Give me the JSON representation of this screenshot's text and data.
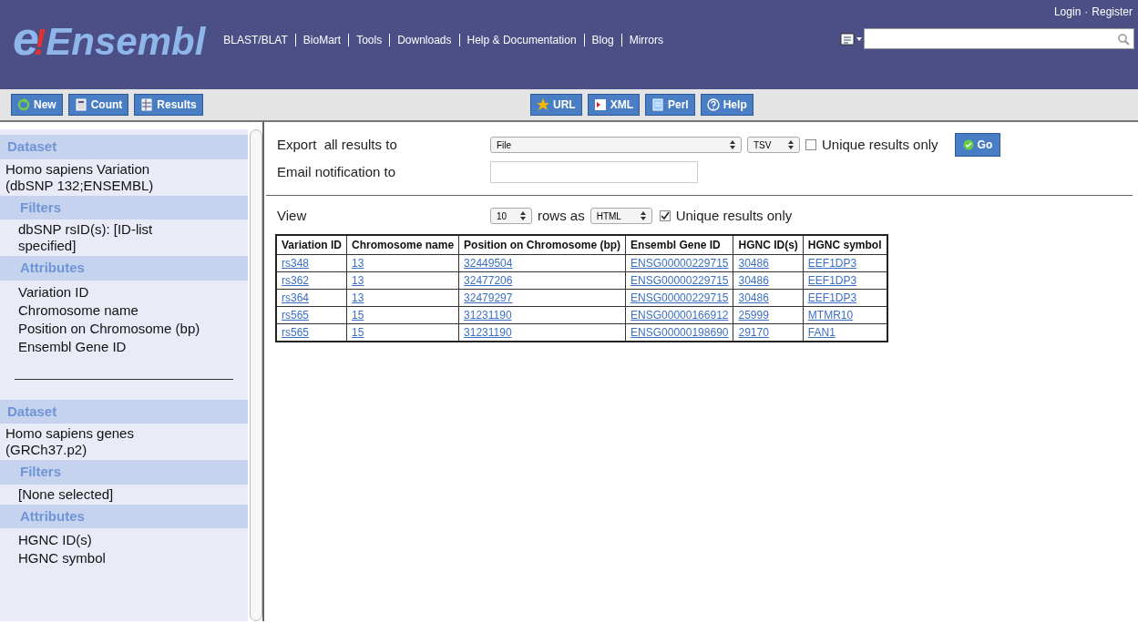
{
  "header": {
    "logo_e": "e",
    "logo_bang": "!",
    "logo_text": "Ensembl",
    "nav": [
      "BLAST/BLAT",
      "BioMart",
      "Tools",
      "Downloads",
      "Help & Documentation",
      "Blog",
      "Mirrors"
    ],
    "account_links": [
      "Login",
      "Register"
    ],
    "account_separator": "·"
  },
  "toolbar": {
    "left": [
      "New",
      "Count",
      "Results"
    ],
    "right": [
      "URL",
      "XML",
      "Perl",
      "Help"
    ]
  },
  "sidebar": {
    "datasets": [
      {
        "heading": "Dataset",
        "name": "Homo sapiens Variation (dbSNP 132;ENSEMBL)",
        "filters_heading": "Filters",
        "filters": [
          "dbSNP rsID(s): [ID-list specified]"
        ],
        "attributes_heading": "Attributes",
        "attributes": [
          "Variation ID",
          "Chromosome name",
          "Position on Chromosome (bp)",
          "Ensembl Gene ID"
        ]
      },
      {
        "heading": "Dataset",
        "name": "Homo sapiens genes (GRCh37.p2)",
        "filters_heading": "Filters",
        "filters": [
          "[None selected]"
        ],
        "attributes_heading": "Attributes",
        "attributes": [
          "HGNC ID(s)",
          "HGNC symbol"
        ]
      }
    ]
  },
  "export": {
    "label": "Export  all results to",
    "destination": "File",
    "format": "TSV",
    "unique_label": "Unique results only",
    "unique_checked": false,
    "go": "Go",
    "email_label": "Email notification to"
  },
  "view": {
    "label": "View",
    "rows": "10",
    "rows_as": "rows as",
    "format": "HTML",
    "unique_label": "Unique results only",
    "unique_checked": true
  },
  "table": {
    "columns": [
      "Variation ID",
      "Chromosome name",
      "Position on Chromosome (bp)",
      "Ensembl Gene ID",
      "HGNC ID(s)",
      "HGNC symbol"
    ],
    "rows": [
      [
        "rs348",
        "13",
        "32449504",
        "ENSG00000229715",
        "30486",
        "EEF1DP3"
      ],
      [
        "rs362",
        "13",
        "32477206",
        "ENSG00000229715",
        "30486",
        "EEF1DP3"
      ],
      [
        "rs364",
        "13",
        "32479297",
        "ENSG00000229715",
        "30486",
        "EEF1DP3"
      ],
      [
        "rs565",
        "15",
        "31231190",
        "ENSG00000166912",
        "25999",
        "MTMR10"
      ],
      [
        "rs565",
        "15",
        "31231190",
        "ENSG00000198690",
        "29170",
        "FAN1"
      ]
    ]
  }
}
